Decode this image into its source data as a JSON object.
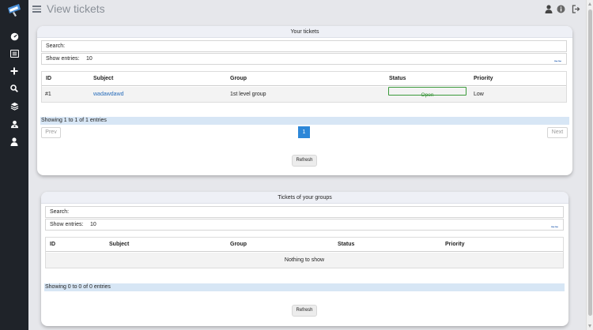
{
  "app": {
    "title": "View tickets"
  },
  "sidebar": {
    "items": [
      {
        "name": "dashboard",
        "icon": "gauge-icon"
      },
      {
        "name": "tickets-list",
        "icon": "list-icon"
      },
      {
        "name": "new-ticket",
        "icon": "plus-icon"
      },
      {
        "name": "search",
        "icon": "search-icon"
      },
      {
        "name": "groups",
        "icon": "layers-icon"
      },
      {
        "name": "users",
        "icon": "user-group-icon"
      },
      {
        "name": "profile",
        "icon": "user-icon"
      }
    ]
  },
  "header": {
    "icons": [
      "user-icon",
      "info-icon",
      "logout-icon"
    ]
  },
  "your_tickets": {
    "title": "Your tickets",
    "search_label": "Search:",
    "show_entries_label": "Show entries:",
    "show_entries_value": "10",
    "columns": [
      "ID",
      "Subject",
      "Group",
      "Status",
      "Priority"
    ],
    "rows": [
      {
        "id": "#1",
        "subject": "wadawdawd",
        "group": "1st level group",
        "status": "Open",
        "priority": "Low"
      }
    ],
    "info": "Showing 1 to 1 of 1 entries",
    "prev_label": "Prev",
    "page": "1",
    "next_label": "Next",
    "refresh_label": "Refresh"
  },
  "group_tickets": {
    "title": "Tickets of your groups",
    "search_label": "Search:",
    "show_entries_label": "Show entries:",
    "show_entries_value": "10",
    "columns": [
      "ID",
      "Subject",
      "Group",
      "Status",
      "Priority"
    ],
    "empty_text": "Nothing to show",
    "info": "Showing 0 to 0 of 0 entries",
    "refresh_label": "Refresh"
  },
  "colors": {
    "sidebar": "#1f2329",
    "accent": "#2d87d8",
    "status_open": "#2a8a2a",
    "info_bar": "#d7e6f5"
  }
}
